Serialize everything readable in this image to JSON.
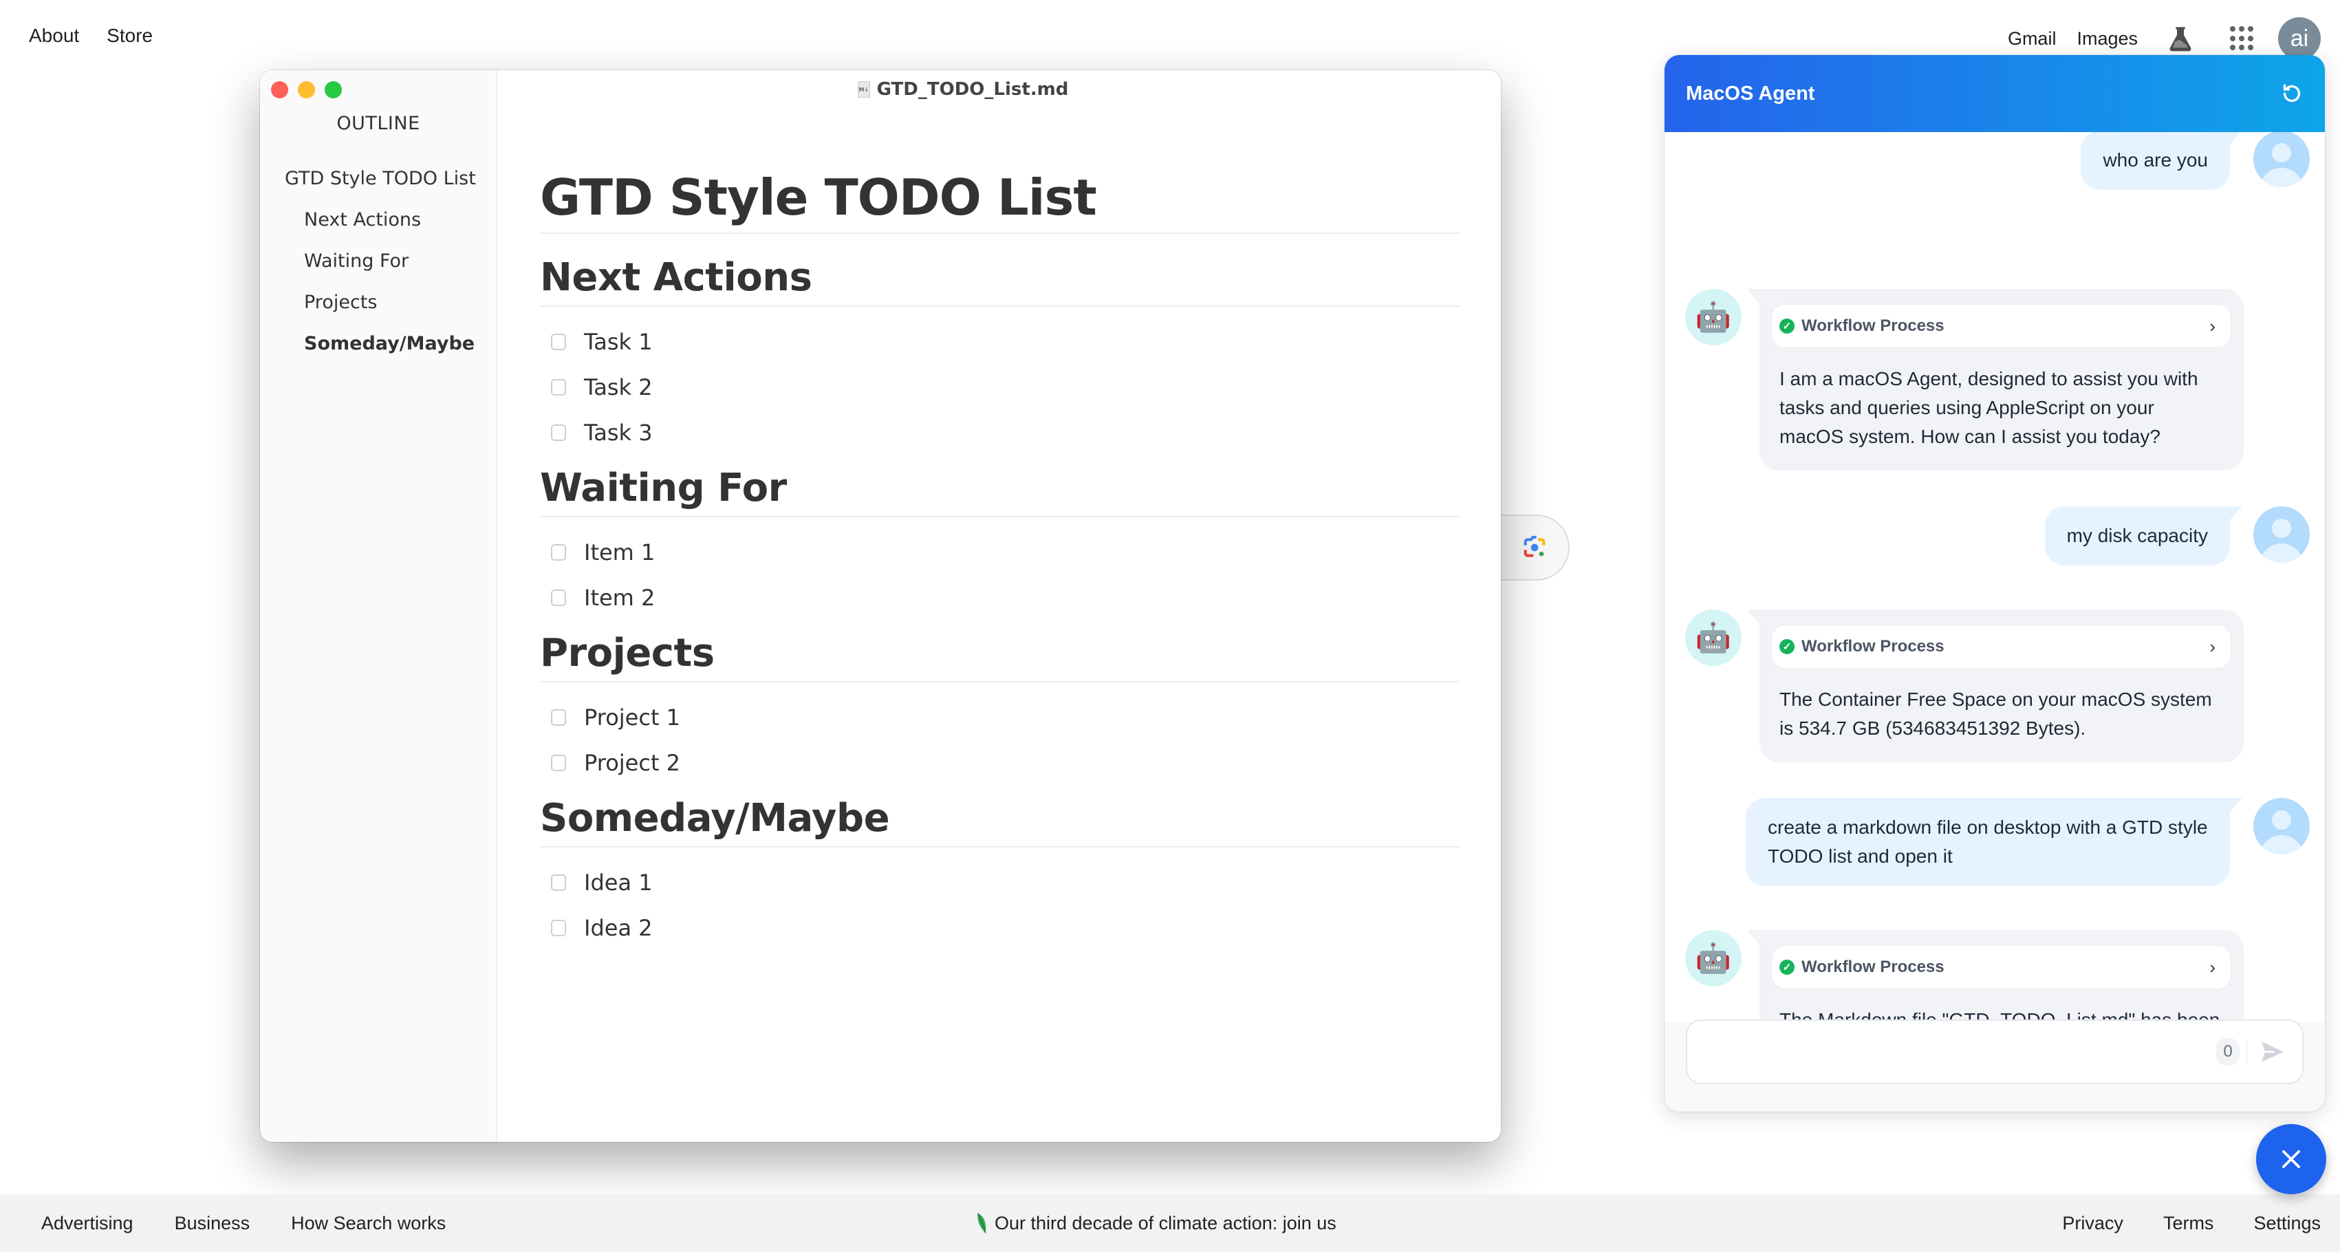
{
  "top_nav": {
    "left_links": [
      "About",
      "Store"
    ],
    "right_links": [
      "Gmail",
      "Images"
    ],
    "labs_icon": "flask-icon",
    "apps_icon": "apps-grid-icon",
    "account_initials": "ai"
  },
  "editor": {
    "filename": "GTD_TODO_List.md",
    "outline": {
      "title": "OUTLINE",
      "items": [
        {
          "label": "GTD Style TODO List",
          "level": 1,
          "active": false
        },
        {
          "label": "Next Actions",
          "level": 2,
          "active": false
        },
        {
          "label": "Waiting For",
          "level": 2,
          "active": false
        },
        {
          "label": "Projects",
          "level": 2,
          "active": false
        },
        {
          "label": "Someday/Maybe",
          "level": 2,
          "active": true
        }
      ]
    },
    "document": {
      "title": "GTD Style TODO List",
      "sections": [
        {
          "heading": "Next Actions",
          "items": [
            {
              "text": "Task 1",
              "checked": false
            },
            {
              "text": "Task 2",
              "checked": false
            },
            {
              "text": "Task 3",
              "checked": false
            }
          ]
        },
        {
          "heading": "Waiting For",
          "items": [
            {
              "text": "Item 1",
              "checked": false
            },
            {
              "text": "Item 2",
              "checked": false
            }
          ]
        },
        {
          "heading": "Projects",
          "items": [
            {
              "text": "Project 1",
              "checked": false
            },
            {
              "text": "Project 2",
              "checked": false
            }
          ]
        },
        {
          "heading": "Someday/Maybe",
          "items": [
            {
              "text": "Idea 1",
              "checked": false
            },
            {
              "text": "Idea 2",
              "checked": false
            }
          ]
        }
      ]
    }
  },
  "lens_icon": "google-lens-icon",
  "chat": {
    "title": "MacOS Agent",
    "refresh_icon": "refresh-icon",
    "messages": [
      {
        "role": "user",
        "text": "who are you"
      },
      {
        "role": "bot",
        "workflow_label": "Workflow Process",
        "workflow_status": "success",
        "text": "I am a macOS Agent, designed to assist you with tasks and queries using AppleScript on your macOS system. How can I assist you today?"
      },
      {
        "role": "user",
        "text": "my disk capacity"
      },
      {
        "role": "bot",
        "workflow_label": "Workflow Process",
        "workflow_status": "success",
        "text": "The Container Free Space on your macOS system is 534.7 GB (534683451392 Bytes)."
      },
      {
        "role": "user",
        "text": "create a markdown file on desktop with a GTD style TODO list and open it"
      },
      {
        "role": "bot",
        "workflow_label": "Workflow Process",
        "workflow_status": "success",
        "text": "The Markdown file \"GTD_TODO_List.md\" has been created on your desktop and opened successfully."
      }
    ],
    "input": {
      "value": "",
      "placeholder": "",
      "char_count": "0"
    },
    "send_icon": "send-icon"
  },
  "fab": {
    "icon": "close-icon"
  },
  "footer": {
    "left_links": [
      "Advertising",
      "Business",
      "How Search works"
    ],
    "center_text": "Our third decade of climate action: join us",
    "right_links": [
      "Privacy",
      "Terms",
      "Settings"
    ],
    "leaf_color": "#34a853"
  },
  "colors": {
    "chat_header_start": "#2563eb",
    "chat_header_end": "#0ea5e9",
    "user_bubble": "#e6f3fe",
    "bot_bubble": "#f2f3f6",
    "fab": "#1d63ed",
    "success": "#16b35a"
  }
}
